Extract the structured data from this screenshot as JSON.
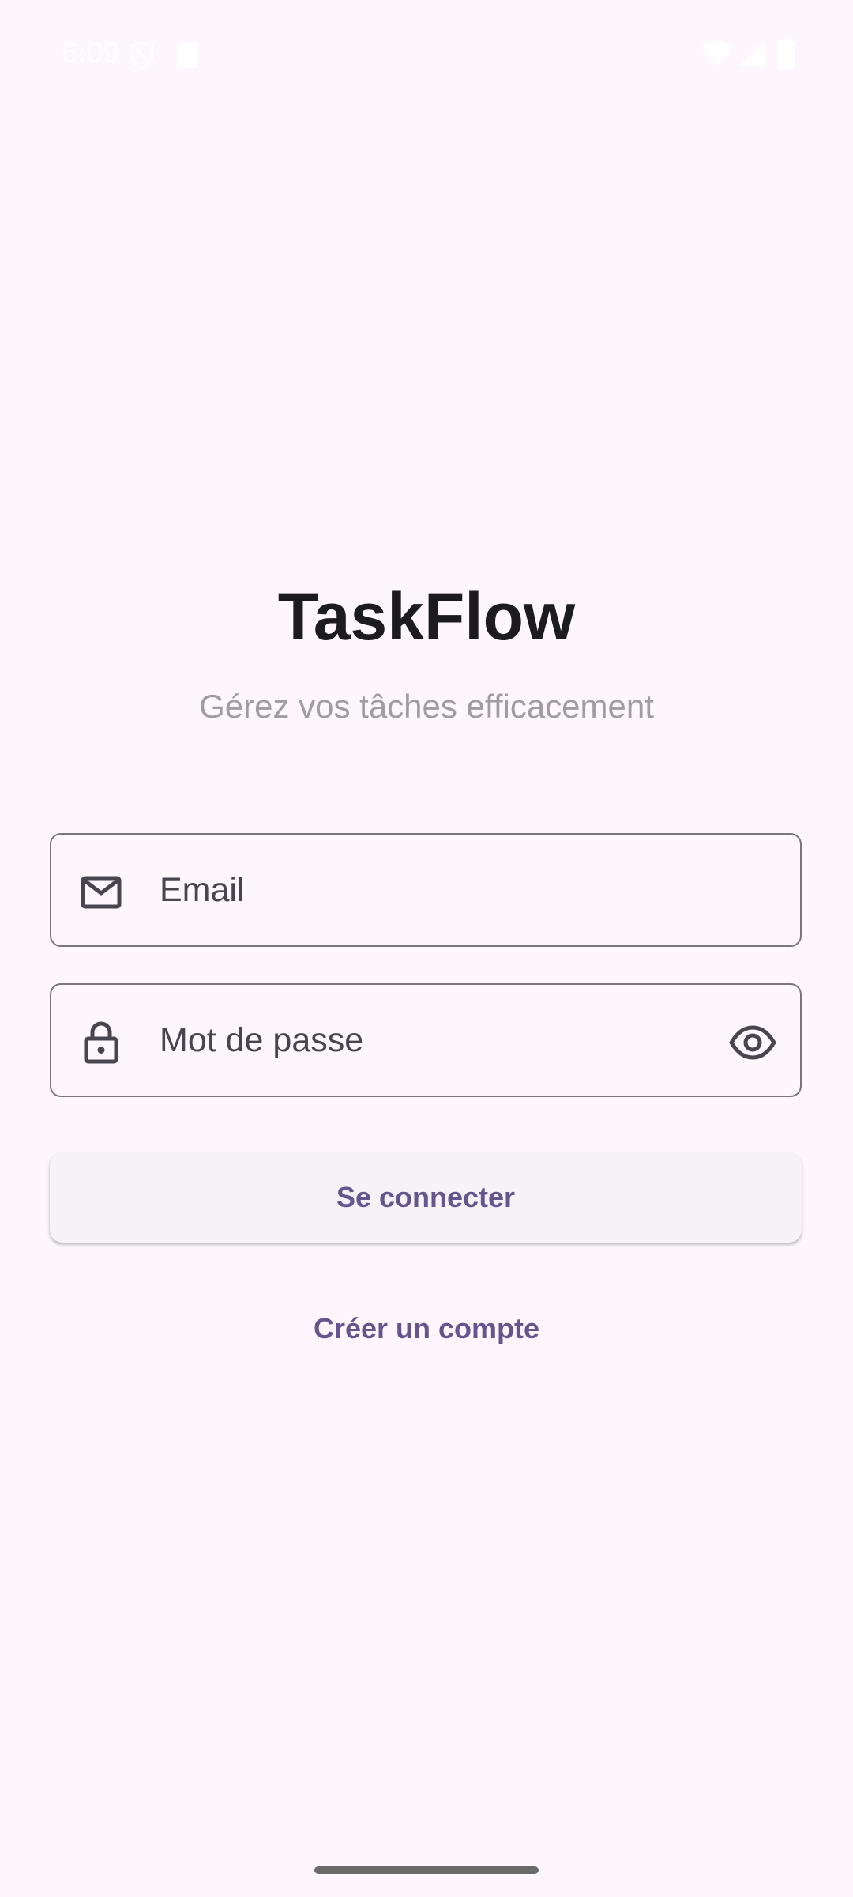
{
  "status_bar": {
    "time": "6:09",
    "icons": [
      "shield-icon",
      "sim-card-icon",
      "wifi-icon",
      "signal-icon",
      "battery-icon"
    ]
  },
  "app": {
    "title": "TaskFlow",
    "subtitle": "Gérez vos tâches efficacement"
  },
  "form": {
    "email": {
      "placeholder": "Email",
      "leading_icon": "mail-icon"
    },
    "password": {
      "placeholder": "Mot de passe",
      "leading_icon": "lock-icon",
      "trailing_icon": "eye-icon"
    }
  },
  "actions": {
    "login_label": "Se connecter",
    "create_account_label": "Créer un compte"
  },
  "colors": {
    "background": "#fdf7fd",
    "primary": "#65558f",
    "outline": "#79747e",
    "title_text": "#1c1b1f",
    "subtitle_text": "#a09ca2"
  }
}
